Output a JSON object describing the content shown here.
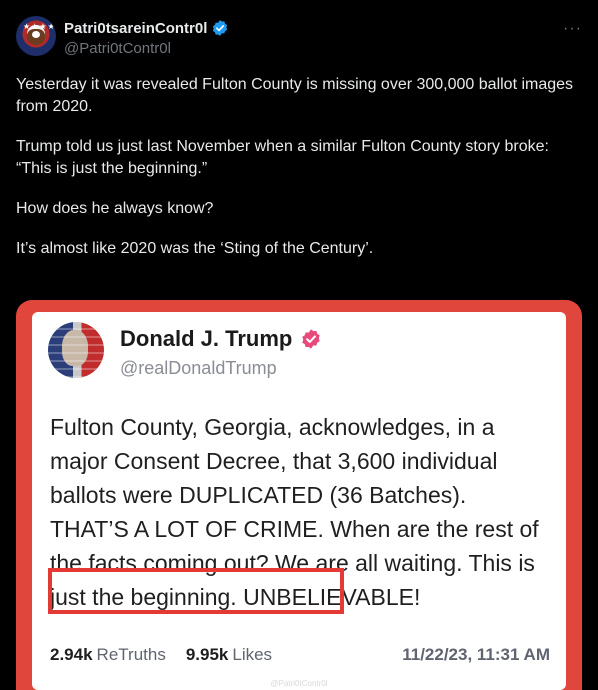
{
  "post": {
    "display_name": "Patri0tsareinContr0l",
    "handle": "@Patri0tContr0l",
    "more_label": "···",
    "verified_icon": "verified-badge-icon",
    "paragraphs": [
      "Yesterday it was revealed Fulton County is missing over 300,000 ballot images from 2020.",
      "Trump told us just last November when a similar Fulton County story broke: “This is just the beginning.”",
      "How does he always know?",
      "It’s almost like 2020 was the ‘Sting of the Century’."
    ]
  },
  "embedded": {
    "name": "Donald J. Trump",
    "handle": "@realDonaldTrump",
    "body": "Fulton County, Georgia, acknowledges, in a major Consent Decree, that 3,600 individual ballots were DUPLICATED (36 Batches). THAT’S A LOT OF CRIME. When are the rest of the facts coming out? We are all waiting. This is just the beginning. UNBELIEVABLE!",
    "retruths_count": "2.94k",
    "retruths_label": "ReTruths",
    "likes_count": "9.95k",
    "likes_label": "Likes",
    "date": "11/22/23, 11:31 AM",
    "watermark": "@Patri0tContr0l"
  },
  "colors": {
    "background": "#000000",
    "x_verified": "#1d9bf0",
    "truth_badge": "#e64b7c",
    "frame_red": "#e0463c",
    "highlight_red": "#e53935"
  }
}
